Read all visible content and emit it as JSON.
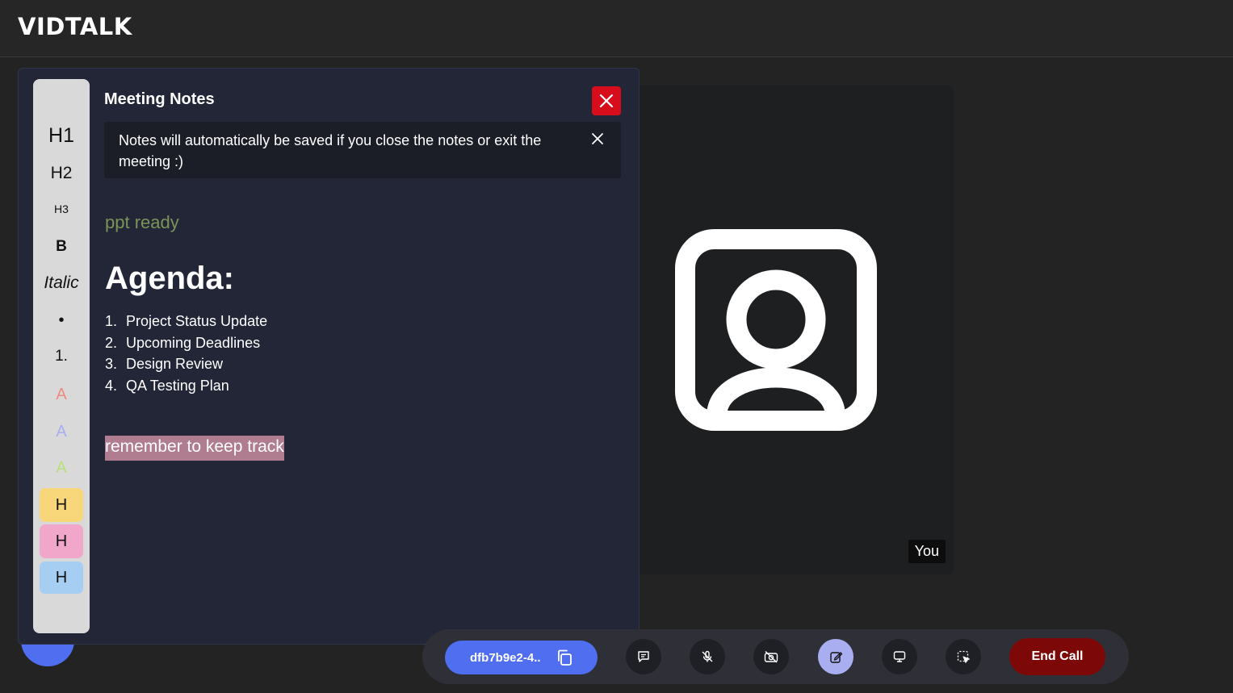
{
  "app": {
    "brand": "VIDTALK"
  },
  "video": {
    "self_label": "You"
  },
  "notes": {
    "title": "Meeting Notes",
    "info_message": "Notes will automatically be saved if you close the notes or exit the meeting :)",
    "toolbar": {
      "h1": "H1",
      "h2": "H2",
      "h3": "H3",
      "bold": "B",
      "italic": "Italic",
      "bullet": "•",
      "numbered": "1.",
      "color_red": "A",
      "color_blue": "A",
      "color_green": "A",
      "highlight_yellow": "H",
      "highlight_pink": "H",
      "highlight_blue": "H"
    },
    "content": {
      "line1": "ppt ready",
      "heading": "Agenda:",
      "agenda_items": [
        {
          "num": "1.",
          "text": "Project Status Update"
        },
        {
          "num": "2.",
          "text": "Upcoming Deadlines"
        },
        {
          "num": "3.",
          "text": "Design Review"
        },
        {
          "num": "4.",
          "text": "QA Testing Plan"
        }
      ],
      "highlight_line": "remember to keep track"
    }
  },
  "controls": {
    "meeting_id": "dfb7b9e2-4..",
    "end_call": "End Call"
  },
  "colors": {
    "accent": "#4f6ff0",
    "close_red": "#d80d1c",
    "end_call": "#7d0808",
    "notes_active": "#a9aef0"
  }
}
